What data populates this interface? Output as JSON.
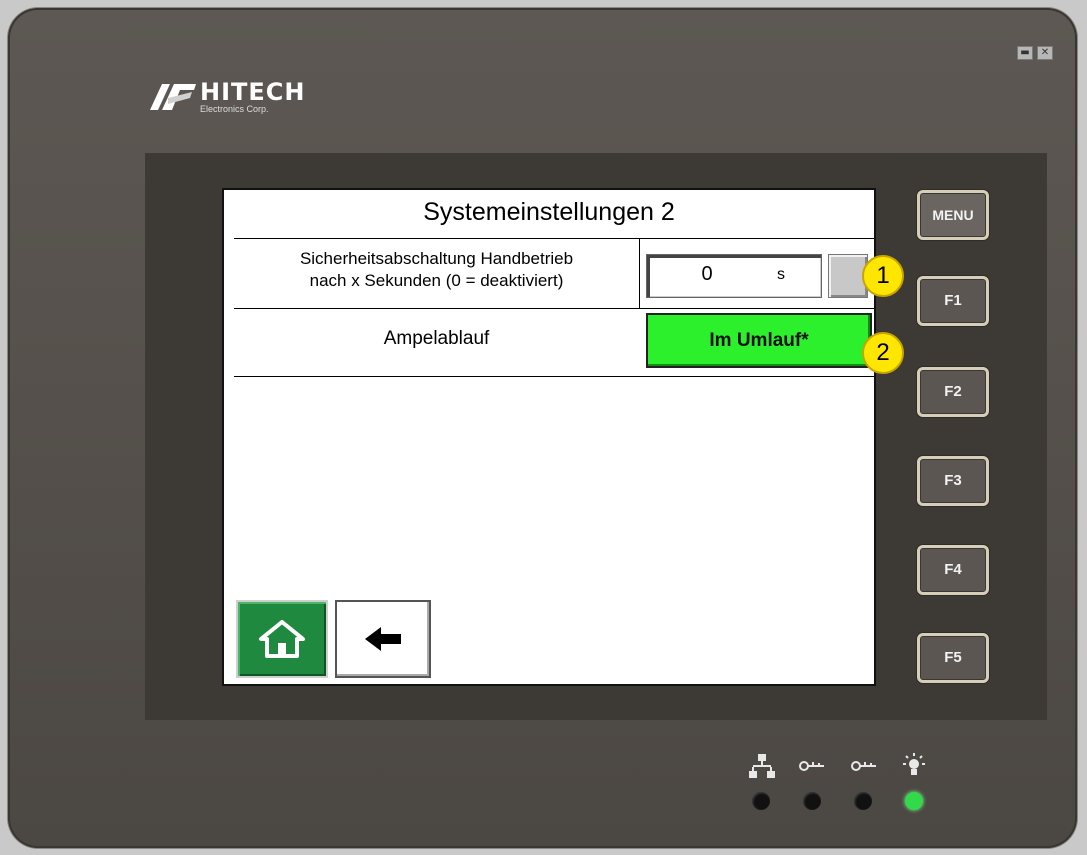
{
  "window": {
    "minimize_icon": "minimize-icon",
    "close_icon": "close-icon"
  },
  "brand": {
    "name": "HITECH",
    "subtitle": "Electronics Corp."
  },
  "screen": {
    "title": "Systemeinstellungen 2",
    "row1": {
      "label_line1": "Sicherheitsabschaltung Handbetrieb",
      "label_line2": "nach x Sekunden (0 = deaktiviert)",
      "value": "0",
      "unit": "s"
    },
    "row2": {
      "label": "Ampelablauf",
      "status": "Im Umlauf*",
      "status_color": "#2cf02c"
    },
    "home_icon": "home-icon",
    "back_icon": "arrow-left-icon"
  },
  "callouts": [
    "1",
    "2"
  ],
  "function_keys": [
    "MENU",
    "F1",
    "F2",
    "F3",
    "F4",
    "F5"
  ],
  "status_indicators": [
    {
      "icon": "network-icon",
      "active": false
    },
    {
      "icon": "key-icon",
      "active": false
    },
    {
      "icon": "key-icon",
      "active": false
    },
    {
      "icon": "light-icon",
      "active": true
    }
  ]
}
